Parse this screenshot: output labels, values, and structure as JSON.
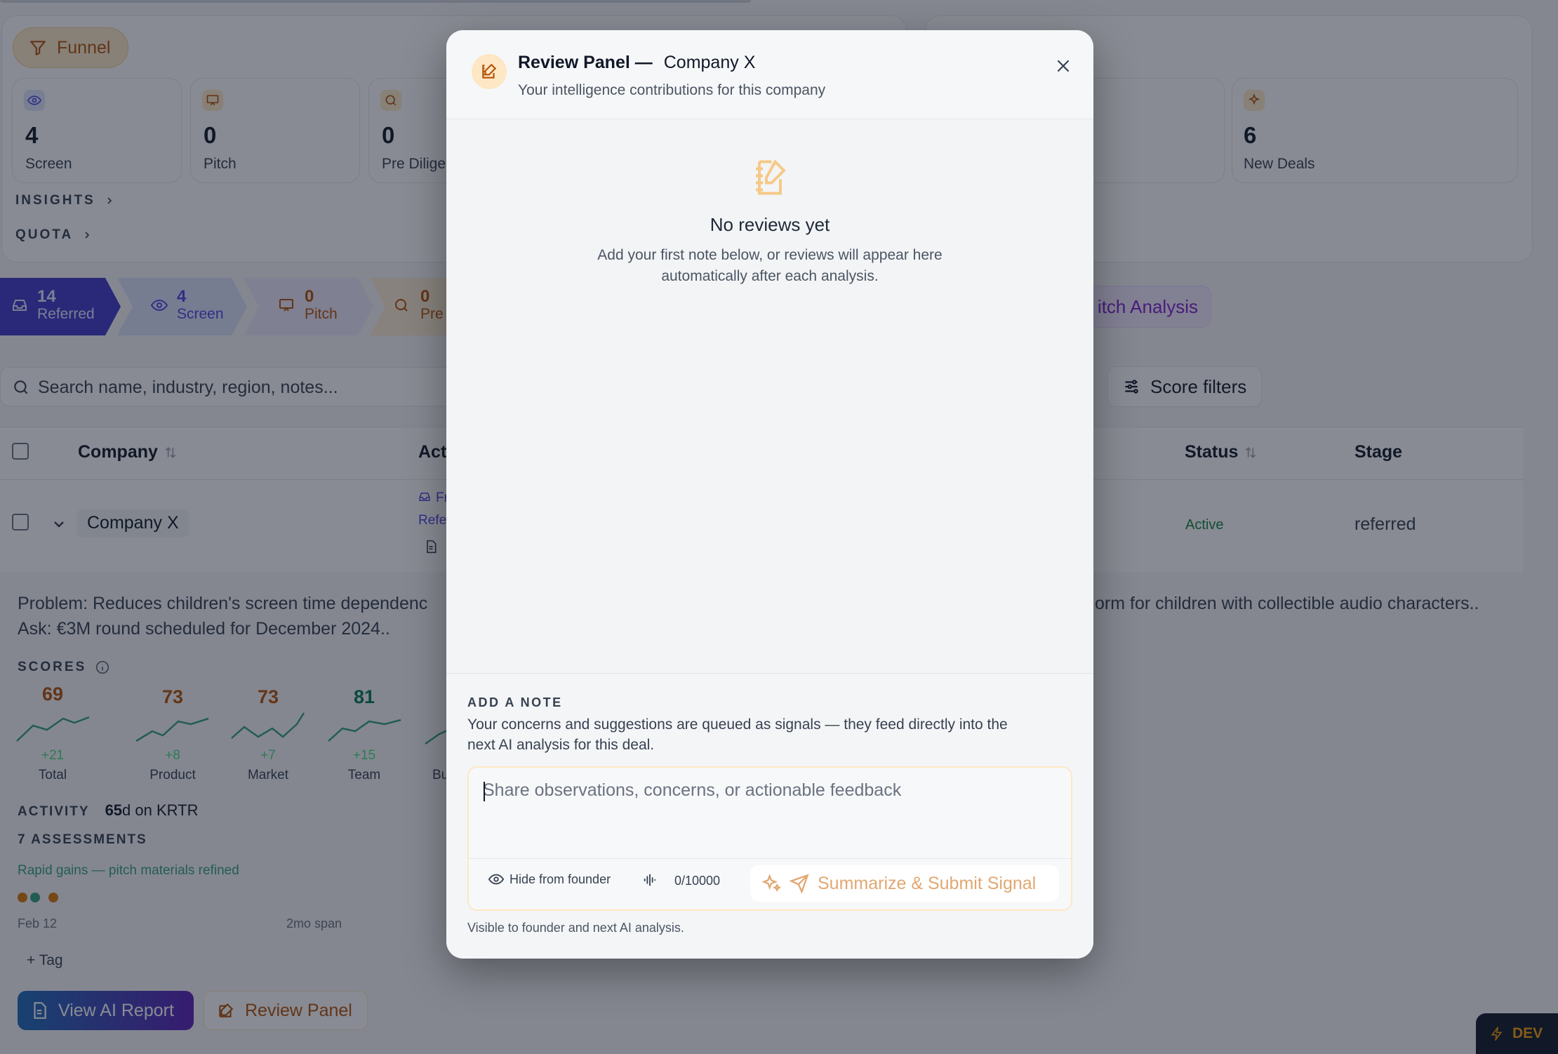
{
  "funnel": {
    "label": "Funnel",
    "stats": [
      {
        "icon": "eye-icon",
        "value": "4",
        "label": "Screen"
      },
      {
        "icon": "presentation-icon",
        "value": "0",
        "label": "Pitch"
      },
      {
        "icon": "search-icon",
        "value": "0",
        "label": "Pre Diligen"
      }
    ],
    "insights_label": "INSIGHTS",
    "quota_label": "QUOTA"
  },
  "deals_card": {
    "value": "6",
    "label": "New Deals",
    "icon": "sparkles-icon"
  },
  "pipeline": [
    {
      "value": "14",
      "label": "Referred",
      "icon": "inbox-icon"
    },
    {
      "value": "4",
      "label": "Screen",
      "icon": "eye-icon"
    },
    {
      "value": "0",
      "label": "Pitch",
      "icon": "presentation-icon"
    },
    {
      "value": "0",
      "label": "Pre",
      "icon": "search-icon"
    }
  ],
  "pitch_analysis_label": "itch Analysis",
  "search": {
    "placeholder": "Search name, industry, region, notes..."
  },
  "score_filters_label": "Score filters",
  "table": {
    "headers": {
      "company": "Company",
      "activity": "Act",
      "status": "Status",
      "stage": "Stage"
    },
    "row": {
      "company": "Company X",
      "activity_line1": "Fr",
      "activity_line2": "Refe",
      "status": "Active",
      "stage": "referred"
    }
  },
  "detail": {
    "problem_left": "Problem: Reduces children's screen time dependenc",
    "problem_right": "orm for children with collectible audio characters..",
    "ask": "Ask: €3M round scheduled for December 2024..",
    "scores_label": "SCORES",
    "scores": [
      {
        "value": 69,
        "delta": "+21",
        "label": "Total",
        "color": "#b45309"
      },
      {
        "value": 73,
        "delta": "+8",
        "label": "Product",
        "color": "#b45309"
      },
      {
        "value": 73,
        "delta": "+7",
        "label": "Market",
        "color": "#b45309"
      },
      {
        "value": 81,
        "delta": "+15",
        "label": "Team",
        "color": "#047857"
      },
      {
        "value": null,
        "delta": "",
        "label": "Bu",
        "color": "#047857"
      }
    ],
    "activity_label": "ACTIVITY",
    "activity_value": "65",
    "activity_suffix": "d on KRTR",
    "assessments_label": "7 ASSESSMENTS",
    "assessment_note": "Rapid gains — pitch materials refined",
    "timeline_start": "Feb 12",
    "timeline_span": "2mo span",
    "tag_label": "+ Tag",
    "view_report_label": "View AI Report",
    "review_panel_label": "Review Panel"
  },
  "dev_badge": "DEV",
  "modal": {
    "title": "Review Panel —",
    "company": "Company X",
    "subtitle": "Your intelligence contributions for this company",
    "empty_title": "No reviews yet",
    "empty_line1": "Add your first note below, or reviews will appear here",
    "empty_line2": "automatically after each analysis.",
    "add_note_label": "ADD A NOTE",
    "add_note_desc1": "Your concerns and suggestions are queued as signals — they feed directly into the",
    "add_note_desc2": "next AI analysis for this deal.",
    "textarea_placeholder": "Share observations, concerns, or actionable feedback",
    "hide_label": "Hide from founder",
    "counter": "0/10000",
    "submit_label": "Summarize & Submit Signal",
    "visibility_note": "Visible to founder and next AI analysis."
  },
  "colors": {
    "amber": "#d97706",
    "amber_soft": "#fde7c4",
    "indigo": "#4f46e5",
    "active_green": "#15803d",
    "overlay": "rgba(17,24,39,0.5)"
  }
}
